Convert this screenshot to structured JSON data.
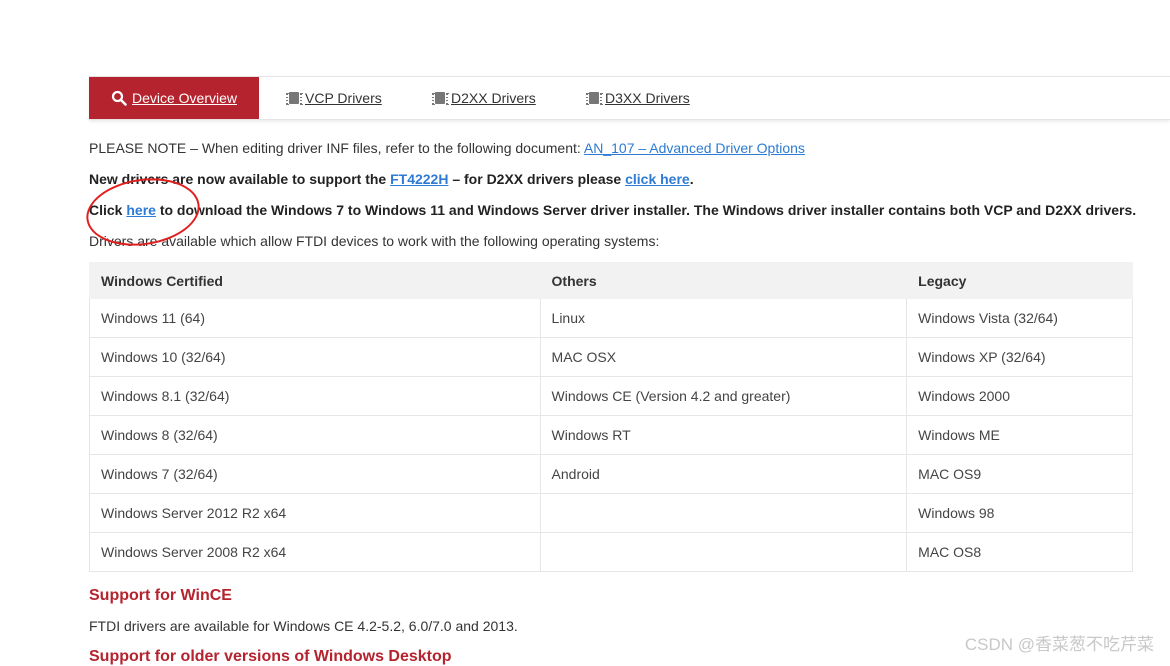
{
  "tabs": [
    {
      "label": "Device Overview",
      "icon": "search-icon",
      "active": true
    },
    {
      "label": "VCP Drivers",
      "icon": "chip-icon"
    },
    {
      "label": "D2XX Drivers",
      "icon": "chip-icon"
    },
    {
      "label": "D3XX Drivers",
      "icon": "chip-icon"
    }
  ],
  "note": {
    "text": "PLEASE NOTE – When editing driver INF files, refer to the following document: ",
    "link": "AN_107 – Advanced Driver Options"
  },
  "new_drivers": {
    "pre": "New drivers are now available to support the ",
    "link1": "FT4222H",
    "mid": " – for D2XX drivers please ",
    "link2": "click here",
    "post": "."
  },
  "installer": {
    "pre": "Click ",
    "link": "here",
    "post": " to download the Windows 7 to Windows 11 and Windows Server driver installer. The Windows driver installer contains both VCP and D2XX drivers."
  },
  "available_text": "Drivers are available which allow FTDI devices to work with the following operating systems:",
  "table": {
    "headers": [
      "Windows Certified",
      "Others",
      "Legacy"
    ],
    "rows": [
      [
        "Windows 11 (64)",
        "Linux",
        "Windows Vista (32/64)"
      ],
      [
        "Windows 10 (32/64)",
        "MAC OSX",
        "Windows XP (32/64)"
      ],
      [
        "Windows 8.1 (32/64)",
        "Windows CE (Version 4.2 and greater)",
        "Windows 2000"
      ],
      [
        "Windows 8 (32/64)",
        "Windows RT",
        "Windows ME"
      ],
      [
        "Windows 7 (32/64)",
        "Android",
        "MAC OS9"
      ],
      [
        "Windows Server 2012 R2 x64",
        "",
        "Windows 98"
      ],
      [
        "Windows Server 2008 R2 x64",
        "",
        "MAC OS8"
      ]
    ]
  },
  "wince": {
    "heading": "Support for WinCE",
    "text": "FTDI drivers are available for Windows CE 4.2-5.2, 6.0/7.0 and 2013."
  },
  "older_heading": "Support for older versions of Windows Desktop",
  "watermark": "CSDN @香菜葱不吃芹菜",
  "colors": {
    "accent": "#b5232e",
    "link": "#2d7bd4",
    "annotation": "#e02020"
  }
}
